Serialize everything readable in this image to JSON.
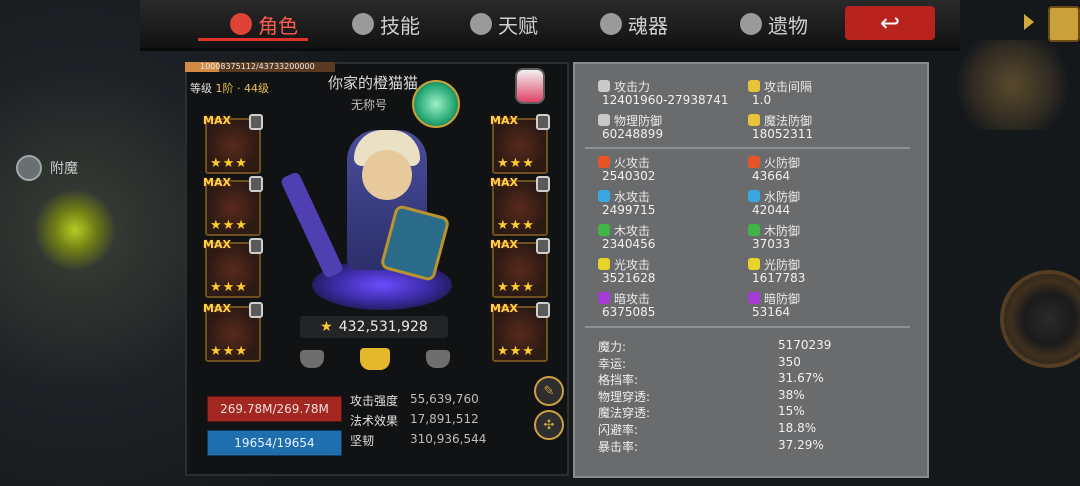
{
  "tabs": [
    {
      "label": "角色",
      "active": true
    },
    {
      "label": "技能",
      "active": false
    },
    {
      "label": "天赋",
      "active": false
    },
    {
      "label": "魂器",
      "active": false
    },
    {
      "label": "遗物",
      "active": false
    }
  ],
  "side": {
    "enchant_label": "附魔"
  },
  "character": {
    "exp_text": "10008375112/43733200000",
    "exp_fraction": 0.229,
    "level_label": "等级",
    "level_value": "1阶 · 44级",
    "name": "你家的橙猫猫",
    "subtitle": "无称号",
    "power": "432,531,928",
    "hp": "269.78M/269.78M",
    "mp": "19654/19654",
    "mini_stats": [
      {
        "label": "攻击强度",
        "value": "55,639,760"
      },
      {
        "label": "法术效果",
        "value": "17,891,512"
      },
      {
        "label": "坚韧",
        "value": "310,936,544"
      }
    ]
  },
  "equipment": {
    "max_label": "MAX",
    "stars": "★★★",
    "left_slots": 4,
    "right_slots": 4
  },
  "stats": {
    "primary": [
      [
        {
          "label": "攻击力",
          "value": "12401960-27938741",
          "color": "#c9c9c9"
        },
        {
          "label": "攻击间隔",
          "value": "1.0",
          "color": "#e5c43a"
        }
      ],
      [
        {
          "label": "物理防御",
          "value": "60248899",
          "color": "#c9c9c9"
        },
        {
          "label": "魔法防御",
          "value": "18052311",
          "color": "#e5c43a"
        }
      ]
    ],
    "elements": [
      [
        {
          "label": "火攻击",
          "value": "2540302",
          "color": "#e55527"
        },
        {
          "label": "火防御",
          "value": "43664",
          "color": "#e55527"
        }
      ],
      [
        {
          "label": "水攻击",
          "value": "2499715",
          "color": "#3aa6e2"
        },
        {
          "label": "水防御",
          "value": "42044",
          "color": "#3aa6e2"
        }
      ],
      [
        {
          "label": "木攻击",
          "value": "2340456",
          "color": "#3fb548"
        },
        {
          "label": "木防御",
          "value": "37033",
          "color": "#3fb548"
        }
      ],
      [
        {
          "label": "光攻击",
          "value": "3521628",
          "color": "#e8d427"
        },
        {
          "label": "光防御",
          "value": "1617783",
          "color": "#e8d427"
        }
      ],
      [
        {
          "label": "暗攻击",
          "value": "6375085",
          "color": "#a63bd6"
        },
        {
          "label": "暗防御",
          "value": "53164",
          "color": "#a63bd6"
        }
      ]
    ],
    "extra": [
      {
        "label": "魔力:",
        "value": "5170239"
      },
      {
        "label": "幸运:",
        "value": "350"
      },
      {
        "label": "格挡率:",
        "value": "31.67%"
      },
      {
        "label": "物理穿透:",
        "value": "38%"
      },
      {
        "label": "魔法穿透:",
        "value": "15%"
      },
      {
        "label": "闪避率:",
        "value": "18.8%"
      },
      {
        "label": "暴击率:",
        "value": "37.29%"
      }
    ]
  }
}
